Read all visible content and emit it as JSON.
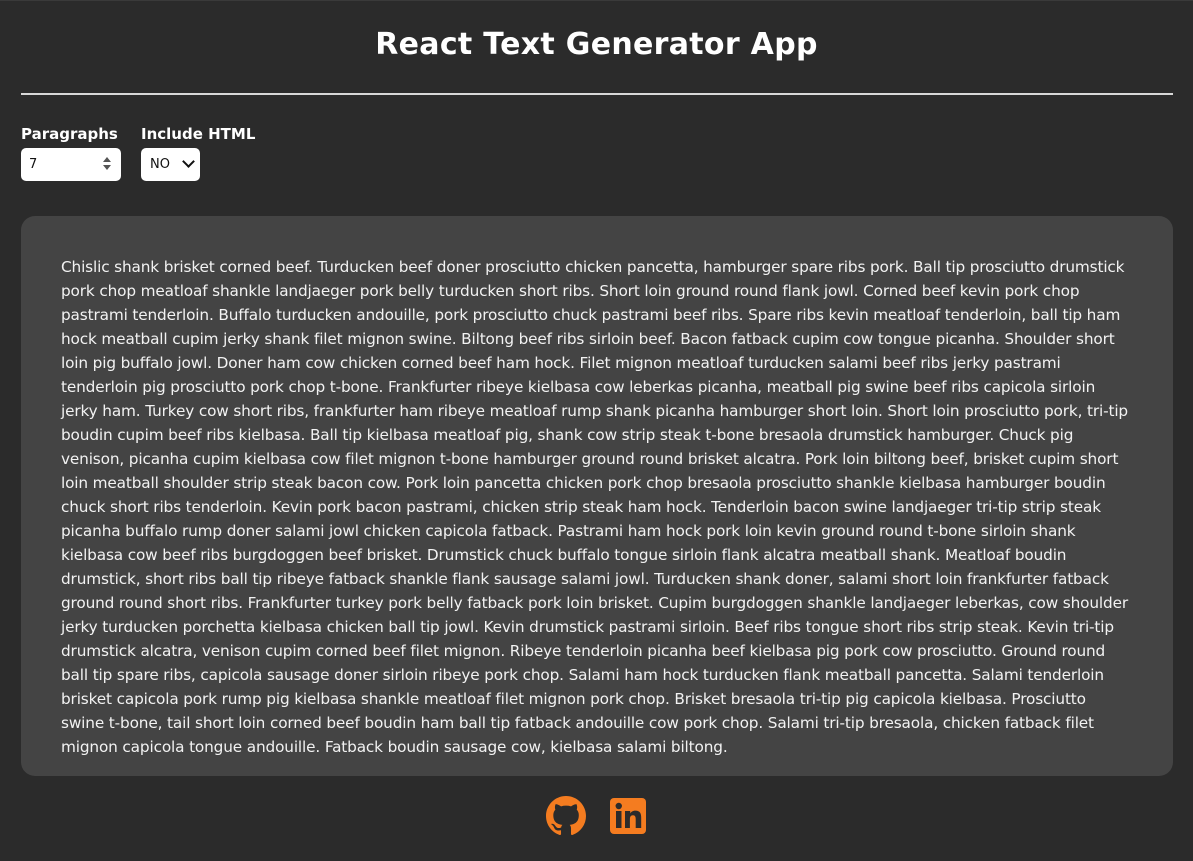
{
  "app": {
    "title": "React Text Generator App"
  },
  "controls": {
    "paragraphs_label": "Paragraphs",
    "paragraphs_value": "7",
    "include_html_label": "Include HTML",
    "include_html_value": "NO"
  },
  "generated_text": "Chislic shank brisket corned beef. Turducken beef doner prosciutto chicken pancetta, hamburger spare ribs pork. Ball tip prosciutto drumstick pork chop meatloaf shankle landjaeger pork belly turducken short ribs. Short loin ground round flank jowl. Corned beef kevin pork chop pastrami tenderloin. Buffalo turducken andouille, pork prosciutto chuck pastrami beef ribs. Spare ribs kevin meatloaf tenderloin, ball tip ham hock meatball cupim jerky shank filet mignon swine. Biltong beef ribs sirloin beef. Bacon fatback cupim cow tongue picanha. Shoulder short loin pig buffalo jowl. Doner ham cow chicken corned beef ham hock. Filet mignon meatloaf turducken salami beef ribs jerky pastrami tenderloin pig prosciutto pork chop t-bone. Frankfurter ribeye kielbasa cow leberkas picanha, meatball pig swine beef ribs capicola sirloin jerky ham. Turkey cow short ribs, frankfurter ham ribeye meatloaf rump shank picanha hamburger short loin. Short loin prosciutto pork, tri-tip boudin cupim beef ribs kielbasa. Ball tip kielbasa meatloaf pig, shank cow strip steak t-bone bresaola drumstick hamburger. Chuck pig venison, picanha cupim kielbasa cow filet mignon t-bone hamburger ground round brisket alcatra. Pork loin biltong beef, brisket cupim short loin meatball shoulder strip steak bacon cow. Pork loin pancetta chicken pork chop bresaola prosciutto shankle kielbasa hamburger boudin chuck short ribs tenderloin. Kevin pork bacon pastrami, chicken strip steak ham hock. Tenderloin bacon swine landjaeger tri-tip strip steak picanha buffalo rump doner salami jowl chicken capicola fatback. Pastrami ham hock pork loin kevin ground round t-bone sirloin shank kielbasa cow beef ribs burgdoggen beef brisket. Drumstick chuck buffalo tongue sirloin flank alcatra meatball shank. Meatloaf boudin drumstick, short ribs ball tip ribeye fatback shankle flank sausage salami jowl. Turducken shank doner, salami short loin frankfurter fatback ground round short ribs. Frankfurter turkey pork belly fatback pork loin brisket. Cupim burgdoggen shankle landjaeger leberkas, cow shoulder jerky turducken porchetta kielbasa chicken ball tip jowl. Kevin drumstick pastrami sirloin. Beef ribs tongue short ribs strip steak. Kevin tri-tip drumstick alcatra, venison cupim corned beef filet mignon. Ribeye tenderloin picanha beef kielbasa pig pork cow prosciutto. Ground round ball tip spare ribs, capicola sausage doner sirloin ribeye pork chop. Salami ham hock turducken flank meatball pancetta. Salami tenderloin brisket capicola pork rump pig kielbasa shankle meatloaf filet mignon pork chop. Brisket bresaola tri-tip pig capicola kielbasa. Prosciutto swine t-bone, tail short loin corned beef boudin ham ball tip fatback andouille cow pork chop. Salami tri-tip bresaola, chicken fatback filet mignon capicola tongue andouille. Fatback boudin sausage cow, kielbasa salami biltong.",
  "footer": {
    "icons": [
      "github-icon",
      "linkedin-icon"
    ]
  },
  "colors": {
    "background": "#2b2b2b",
    "panel": "#444444",
    "accent": "#f47c20",
    "text": "#ffffff"
  }
}
